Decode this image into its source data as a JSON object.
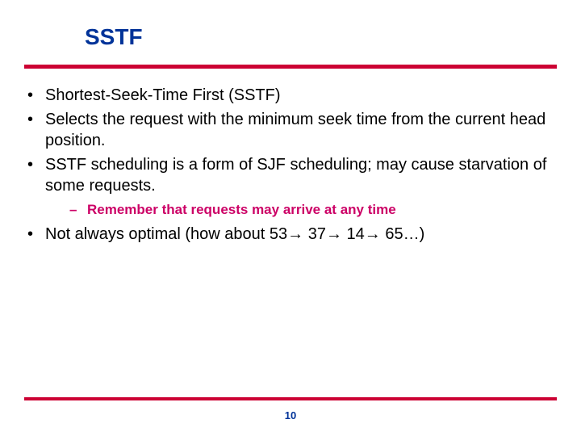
{
  "title": "SSTF",
  "bullets": {
    "b0": "Shortest-Seek-Time First (SSTF)",
    "b1": "Selects the request with the minimum seek time from the current head position.",
    "b2": "SSTF scheduling is a form of SJF scheduling; may cause starvation of some requests.",
    "sub0": "Remember that requests may arrive at any time",
    "b3": "Not always optimal (how about 53→ 37→ 14→ 65…)"
  },
  "page_number": "10"
}
